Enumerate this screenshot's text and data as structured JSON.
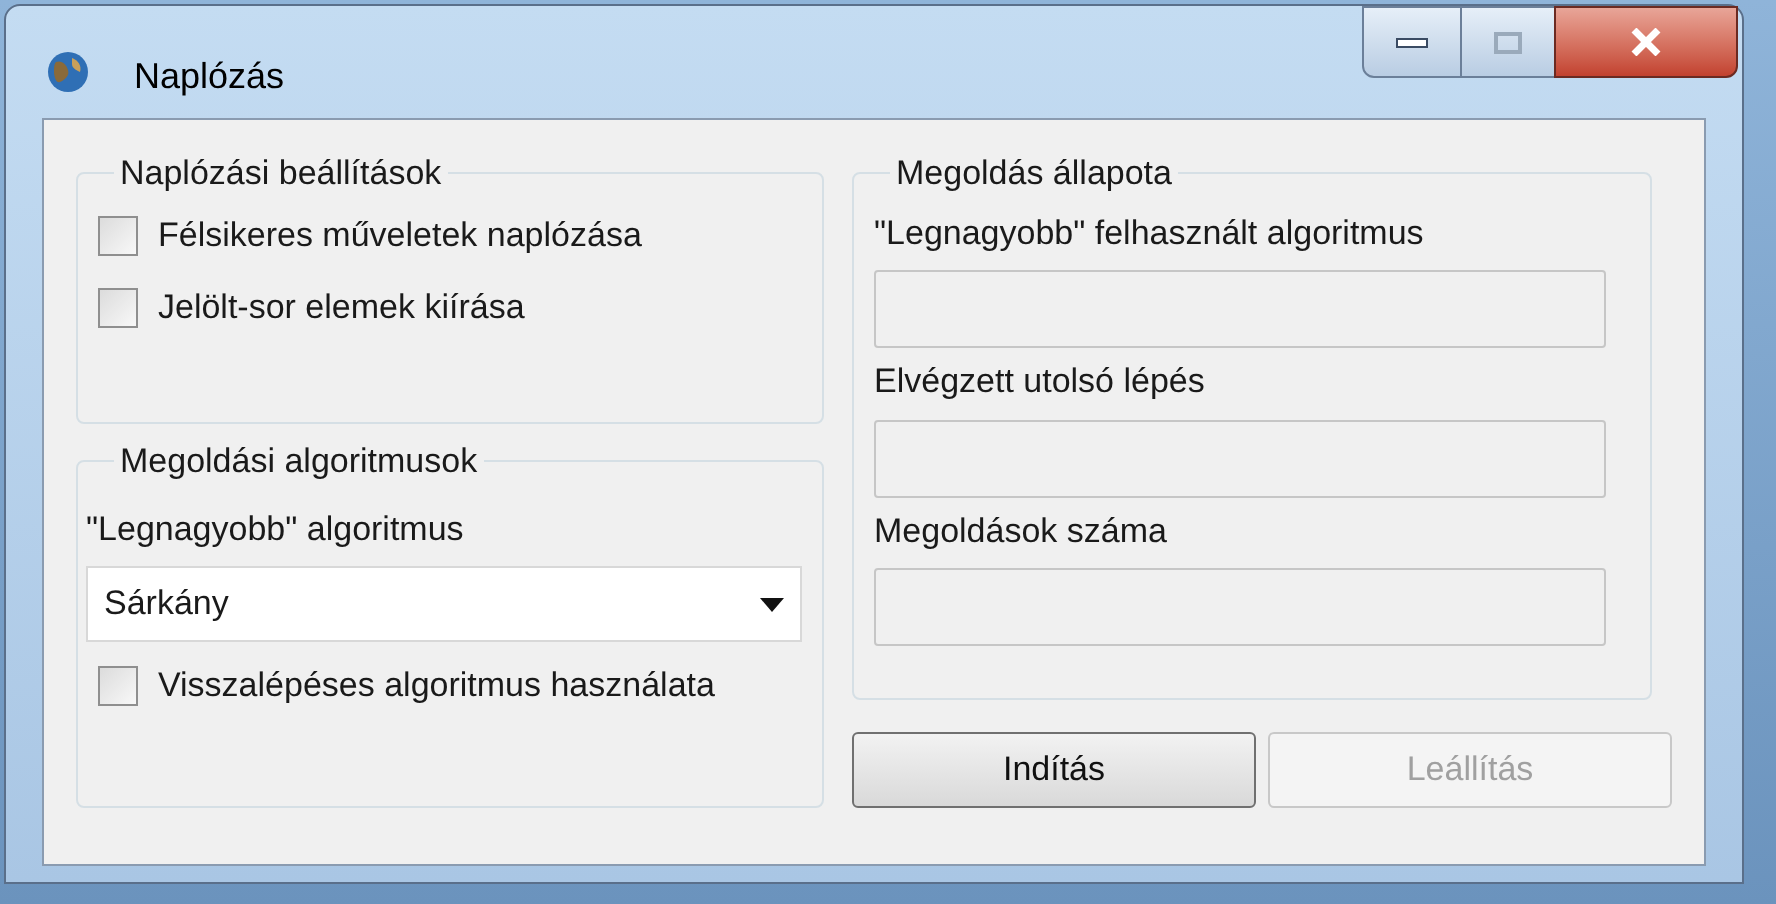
{
  "window": {
    "title": "Naplózás"
  },
  "logging_settings": {
    "title": "Naplózási beállítások",
    "options": [
      {
        "label": "Félsikeres műveletek naplózása",
        "checked": false
      },
      {
        "label": "Jelölt-sor elemek kiírása",
        "checked": false
      }
    ]
  },
  "algorithms": {
    "title": "Megoldási algoritmusok",
    "dropdown_label": "\"Legnagyobb\" algoritmus",
    "dropdown": {
      "value": "Sárkány"
    },
    "options": [
      {
        "label": "Visszalépéses algoritmus használata",
        "checked": false
      }
    ]
  },
  "status": {
    "title": "Megoldás állapota",
    "fields": [
      {
        "label": "\"Legnagyobb\" felhasznált algoritmus"
      },
      {
        "label": "Elvégzett utolsó lépés"
      },
      {
        "label": "Megoldások száma"
      }
    ]
  },
  "buttons": [
    {
      "label": "Indítás",
      "disabled": false
    },
    {
      "label": "Leállítás",
      "disabled": true
    }
  ]
}
